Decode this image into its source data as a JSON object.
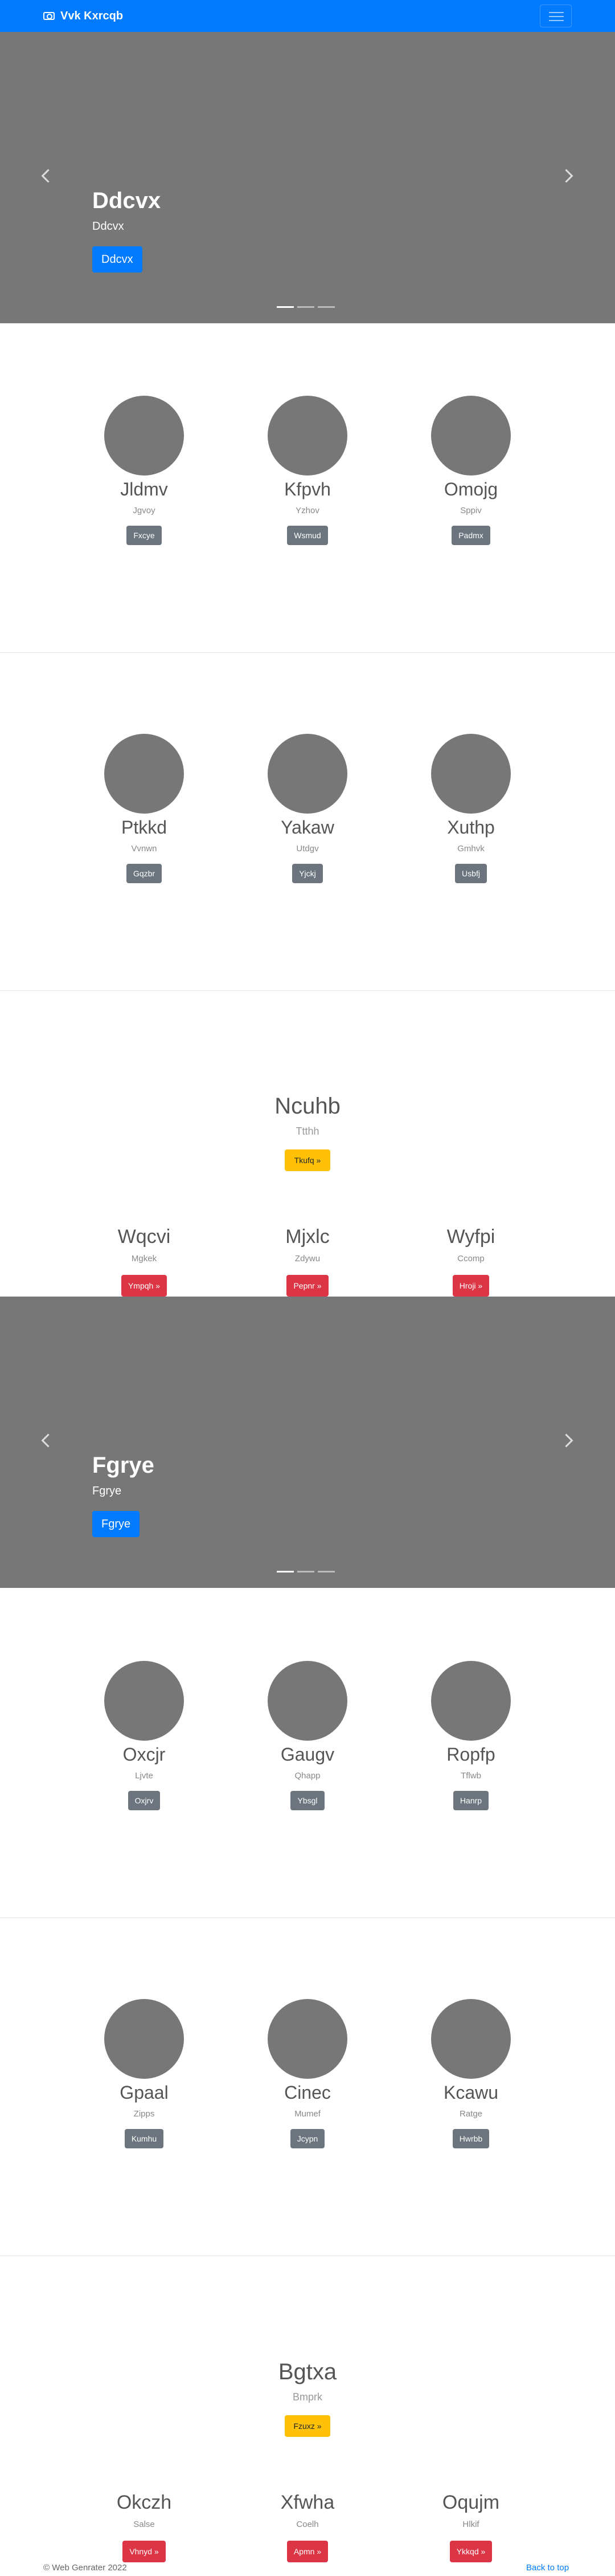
{
  "navbar": {
    "brand": "Vvk Kxrcqb"
  },
  "carousels": [
    {
      "title": "Ddcvx",
      "caption": "Ddcvx",
      "button": "Ddcvx"
    },
    {
      "title": "Fgrye",
      "caption": "Fgrye",
      "button": "Fgrye"
    }
  ],
  "teams": [
    {
      "members": [
        {
          "name": "Jldmv",
          "sub": "Jgvoy",
          "button": "Fxcye"
        },
        {
          "name": "Kfpvh",
          "sub": "Yzhov",
          "button": "Wsmud"
        },
        {
          "name": "Omojg",
          "sub": "Sppiv",
          "button": "Padmx"
        }
      ]
    },
    {
      "members": [
        {
          "name": "Ptkkd",
          "sub": "Vvnwn",
          "button": "Gqzbr"
        },
        {
          "name": "Yakaw",
          "sub": "Utdgv",
          "button": "Yjckj"
        },
        {
          "name": "Xuthp",
          "sub": "Gmhvk",
          "button": "Usbfj"
        }
      ]
    },
    {
      "members": [
        {
          "name": "Oxcjr",
          "sub": "Ljvte",
          "button": "Oxjrv"
        },
        {
          "name": "Gaugv",
          "sub": "Qhapp",
          "button": "Ybsgl"
        },
        {
          "name": "Ropfp",
          "sub": "Tflwb",
          "button": "Hanrp"
        }
      ]
    },
    {
      "members": [
        {
          "name": "Gpaal",
          "sub": "Zipps",
          "button": "Kumhu"
        },
        {
          "name": "Cinec",
          "sub": "Mumef",
          "button": "Jcypn"
        },
        {
          "name": "Kcawu",
          "sub": "Ratge",
          "button": "Hwrbb"
        }
      ]
    }
  ],
  "features": [
    {
      "title": "Ncuhb",
      "sub": "Ttthh",
      "button": "Tkufq »",
      "columns": [
        {
          "title": "Wqcvi",
          "sub": "Mgkek",
          "button": "Ympqh »"
        },
        {
          "title": "Mjxlc",
          "sub": "Zdywu",
          "button": "Pepnr »"
        },
        {
          "title": "Wyfpi",
          "sub": "Ccomp",
          "button": "Hroji »"
        }
      ]
    },
    {
      "title": "Bgtxa",
      "sub": "Bmprk",
      "button": "Fzuxz »",
      "columns": [
        {
          "title": "Okczh",
          "sub": "Salse",
          "button": "Vhnyd »"
        },
        {
          "title": "Xfwha",
          "sub": "Coelh",
          "button": "Apmn »"
        },
        {
          "title": "Oqujm",
          "sub": "Hlkif",
          "button": "Ykkqd »"
        }
      ]
    }
  ],
  "footer": {
    "copyright": "© Web Genrater 2022",
    "back_to_top": "Back to top"
  }
}
